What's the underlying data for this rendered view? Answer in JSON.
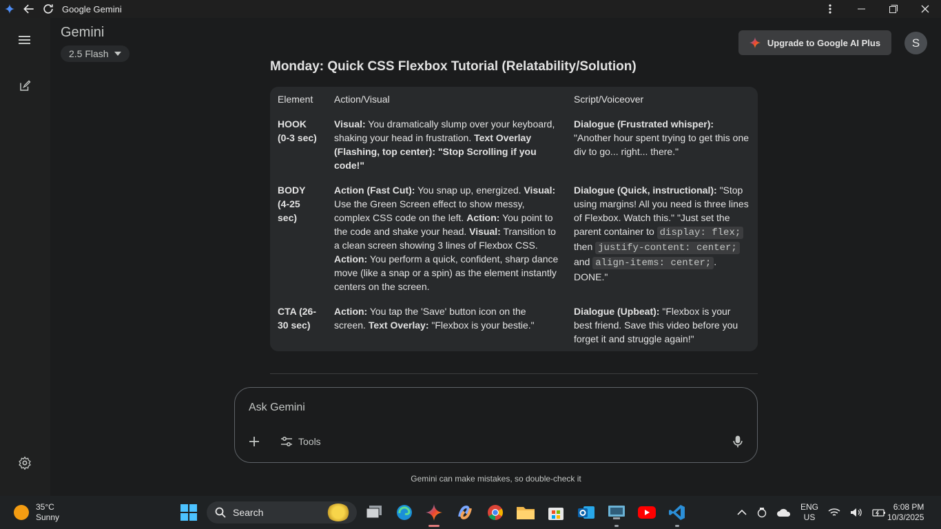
{
  "window": {
    "title": "Google Gemini"
  },
  "header": {
    "app_title": "Gemini",
    "model": "2.5 Flash",
    "upgrade_label": "Upgrade to Google AI Plus",
    "avatar_initial": "S"
  },
  "content": {
    "section_heading": "Monday: Quick CSS Flexbox Tutorial (Relatability/Solution)",
    "table": {
      "headers": [
        "Element",
        "Action/Visual",
        "Script/Voiceover"
      ],
      "rows": [
        {
          "element": "HOOK (0-3 sec)",
          "action": [
            {
              "b": "Visual:"
            },
            {
              "t": " You dramatically slump over your keyboard, shaking your head in frustration. "
            },
            {
              "b": "Text Overlay (Flashing, top center): \"Stop Scrolling if you code!\""
            }
          ],
          "script": [
            {
              "b": "Dialogue (Frustrated whisper):"
            },
            {
              "t": " \"Another hour spent trying to get this one div to go... right... there.\""
            }
          ]
        },
        {
          "element": "BODY (4-25 sec)",
          "action": [
            {
              "b": "Action (Fast Cut):"
            },
            {
              "t": " You snap up, energized. "
            },
            {
              "b": "Visual:"
            },
            {
              "t": " Use the Green Screen effect to show messy, complex CSS code on the left. "
            },
            {
              "b": "Action:"
            },
            {
              "t": " You point to the code and shake your head. "
            },
            {
              "b": "Visual:"
            },
            {
              "t": " Transition to a clean screen showing 3 lines of Flexbox CSS. "
            },
            {
              "b": "Action:"
            },
            {
              "t": " You perform a quick, confident, sharp dance move (like a snap or a spin) as the element instantly centers on the screen."
            }
          ],
          "script": [
            {
              "b": "Dialogue (Quick, instructional):"
            },
            {
              "t": " \"Stop using margins! All you need is three lines of Flexbox. Watch this.\" \"Just set the parent container to "
            },
            {
              "c": "display: flex;"
            },
            {
              "t": " then "
            },
            {
              "c": "justify-content: center;"
            },
            {
              "t": " and "
            },
            {
              "c": "align-items: center;"
            },
            {
              "t": ". DONE.\""
            }
          ]
        },
        {
          "element": "CTA (26-30 sec)",
          "action": [
            {
              "b": "Action:"
            },
            {
              "t": " You tap the 'Save' button icon on the screen. "
            },
            {
              "b": "Text Overlay:"
            },
            {
              "t": " \"Flexbox is your bestie.\""
            }
          ],
          "script": [
            {
              "b": "Dialogue (Upbeat):"
            },
            {
              "t": " \"Flexbox is your best friend. Save this video before you forget it and struggle again!\""
            }
          ]
        }
      ]
    }
  },
  "input": {
    "placeholder": "Ask Gemini",
    "tools_label": "Tools"
  },
  "disclaimer": "Gemini can make mistakes, so double-check it",
  "taskbar": {
    "weather_temp": "35°C",
    "weather_desc": "Sunny",
    "search_label": "Search",
    "lang_line1": "ENG",
    "lang_line2": "US",
    "time": "6:08 PM",
    "date": "10/3/2025",
    "apps": [
      "task-view",
      "edge",
      "gemini",
      "copilot",
      "chrome",
      "file-explorer",
      "microsoft-store",
      "outlook",
      "remote-desktop",
      "youtube",
      "vscode"
    ]
  },
  "colors": {
    "background": "#1b1c1d",
    "sidebar": "#1f2020",
    "table_bg": "#282a2c",
    "upgrade_bg": "#3c3d3f"
  }
}
